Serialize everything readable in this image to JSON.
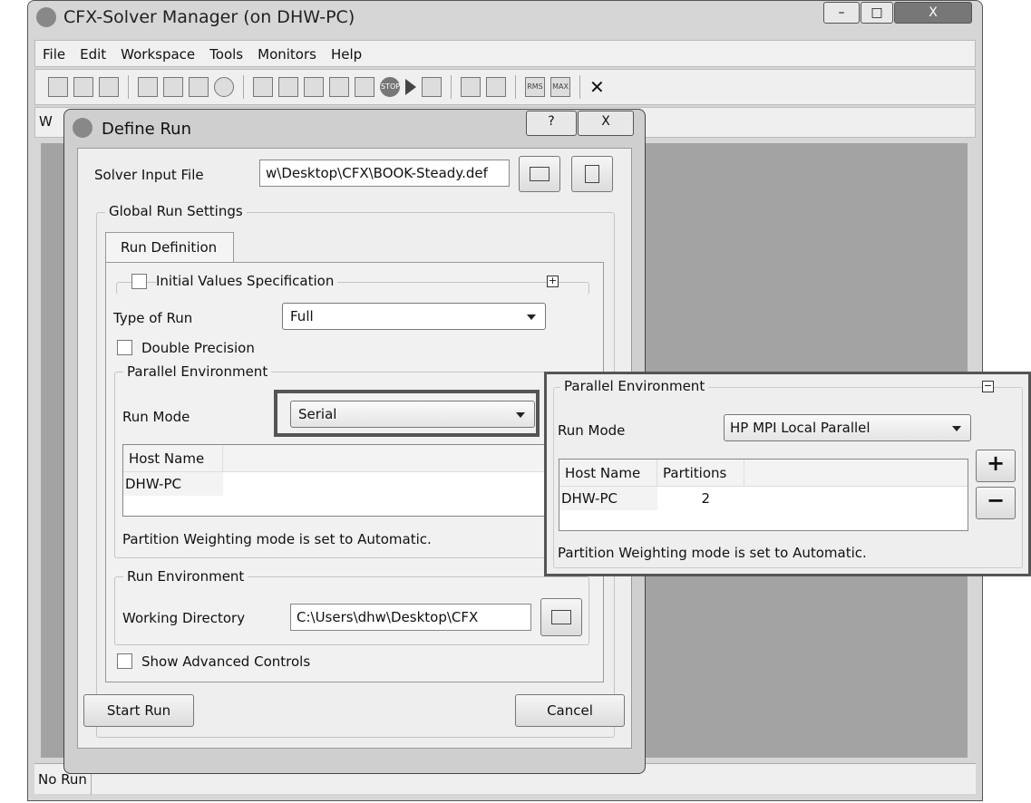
{
  "window": {
    "title": "CFX-Solver Manager (on DHW-PC)",
    "min": "–",
    "max": "□",
    "close": "X"
  },
  "menu": [
    "File",
    "Edit",
    "Workspace",
    "Tools",
    "Monitors",
    "Help"
  ],
  "toolbar": {
    "icons": [
      "new-icon",
      "open-run-icon",
      "open-results-icon",
      "edit-icon",
      "copy-icon",
      "interpolate-icon",
      "view-icon",
      "monitor-icon",
      "small-monitor-icon",
      "text-output-icon",
      "layout-icon",
      "workspace-icon",
      "stop-icon",
      "play-icon",
      "save-icon",
      "plot-icon",
      "edit-plot-icon",
      "rms-icon",
      "max-icon"
    ],
    "rms": "RMS",
    "max": "MAX",
    "stop": "STOP",
    "close": "✕"
  },
  "toolbar2": {
    "partial": "W"
  },
  "status": "No Run",
  "dialog": {
    "title": "Define Run",
    "help": "?",
    "close": "X",
    "solver_input_label": "Solver Input File",
    "solver_input_value": "w\\Desktop\\CFX\\BOOK-Steady.def",
    "global_label": "Global Run Settings",
    "tab": "Run Definition",
    "initial_values": "Initial Values Specification",
    "type_of_run_label": "Type of Run",
    "type_of_run_value": "Full",
    "double_precision": "Double Precision",
    "parallel_label": "Parallel Environment",
    "run_mode_label": "Run Mode",
    "run_mode_value": "Serial",
    "host_header": "Host Name",
    "host_value": "DHW-PC",
    "weighting": "Partition Weighting mode is set to Automatic.",
    "run_env_label": "Run Environment",
    "working_dir_label": "Working Directory",
    "working_dir_value": "C:\\Users\\dhw\\Desktop\\CFX",
    "advanced": "Show Advanced Controls",
    "start": "Start Run",
    "cancel": "Cancel"
  },
  "overlay": {
    "title": "Parallel Environment",
    "run_mode_label": "Run Mode",
    "run_mode_value": "HP MPI Local Parallel",
    "headers": [
      "Host Name",
      "Partitions"
    ],
    "rows": [
      [
        "DHW-PC",
        "2"
      ]
    ],
    "weighting": "Partition Weighting mode is set to Automatic.",
    "plus": "+",
    "minus": "−"
  }
}
